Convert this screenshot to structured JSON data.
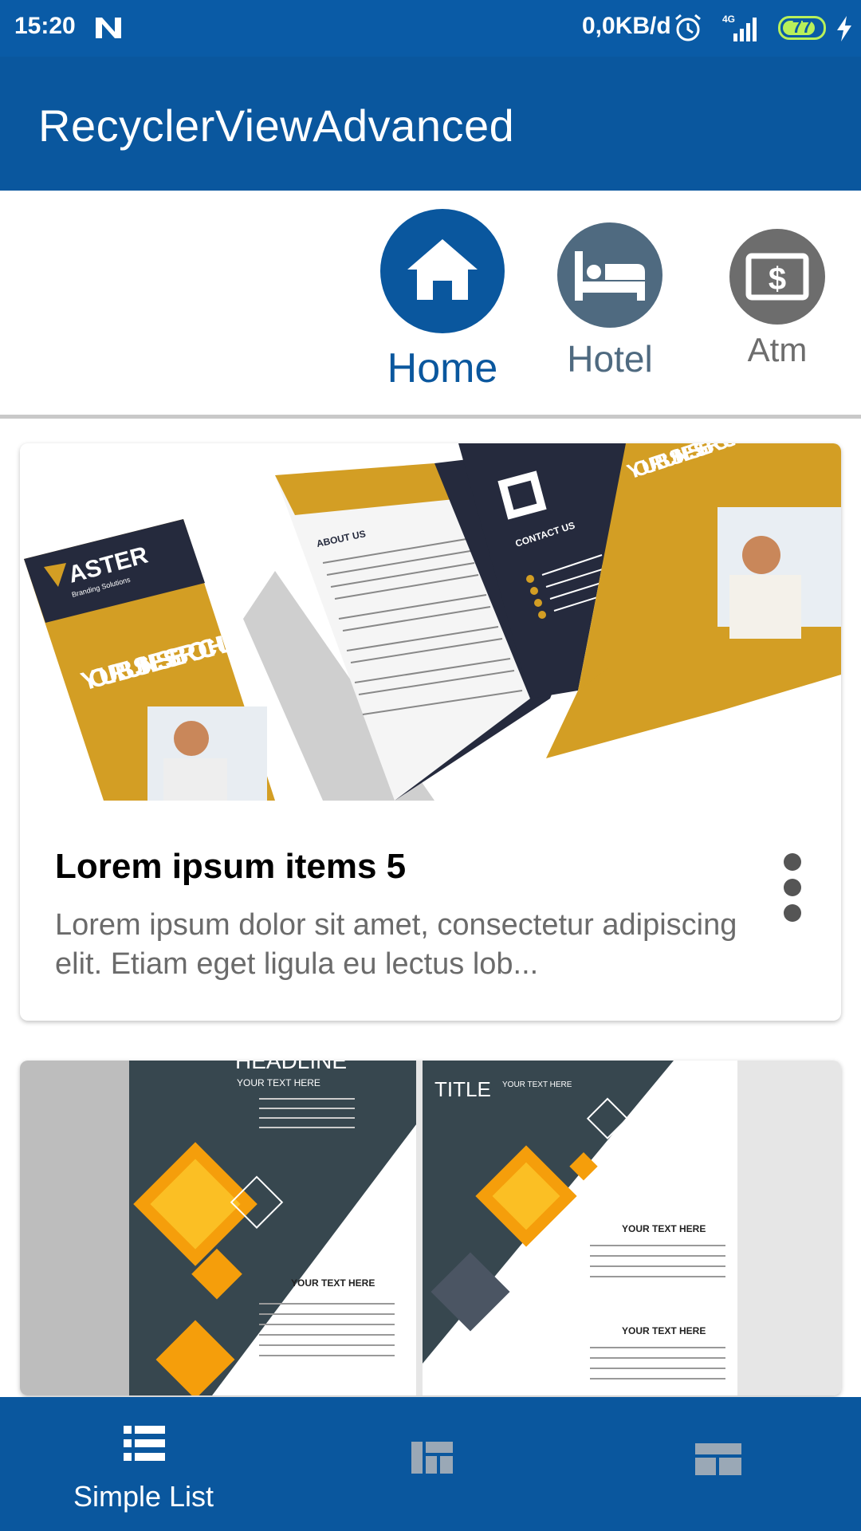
{
  "status_bar": {
    "time": "15:20",
    "network_speed": "0,0KB/d",
    "network_type": "4G",
    "battery": "77"
  },
  "app_bar": {
    "title": "RecyclerViewAdvanced"
  },
  "categories": [
    {
      "label": "Home",
      "icon": "home-icon",
      "selected": true
    },
    {
      "label": "Hotel",
      "icon": "bed-icon",
      "selected": false
    },
    {
      "label": "Atm",
      "icon": "dollar-icon",
      "selected": false
    }
  ],
  "cards": [
    {
      "image": "business-brochure-image",
      "title": "Lorem ipsum items 5",
      "description": "Lorem ipsum dolor sit amet, consectetur adipiscing elit. Etiam eget ligula eu lectus lob..."
    },
    {
      "image": "headline-brochure-image"
    }
  ],
  "brochure_1": {
    "brand": "ASTER",
    "brand_sub": "Branding Solutions",
    "cover_text": "YOUR BUSINESS BROCHURE",
    "about": "ABOUT US",
    "contact": "CONTACT US"
  },
  "brochure_2": {
    "headline": "HEADLINE",
    "sub": "YOUR TEXT HERE",
    "title": "TITLE",
    "section_a": "YOUR TEXT HERE",
    "section_b": "YOUR TEXT HERE",
    "section_c": "YOUR TEXT HERE"
  },
  "bottom_nav": {
    "items": [
      {
        "label": "Simple List",
        "icon": "list-icon",
        "selected": true
      },
      {
        "label": "",
        "icon": "grid-icon",
        "selected": false
      },
      {
        "label": "",
        "icon": "staggered-icon",
        "selected": false
      }
    ]
  },
  "colors": {
    "primary": "#0a579e",
    "status": "#0a5ba6",
    "hotel": "#4f6a80",
    "atm": "#6d6d6d",
    "gold": "#d39e24",
    "navy": "#252a3d",
    "orange": "#f59e0b"
  }
}
